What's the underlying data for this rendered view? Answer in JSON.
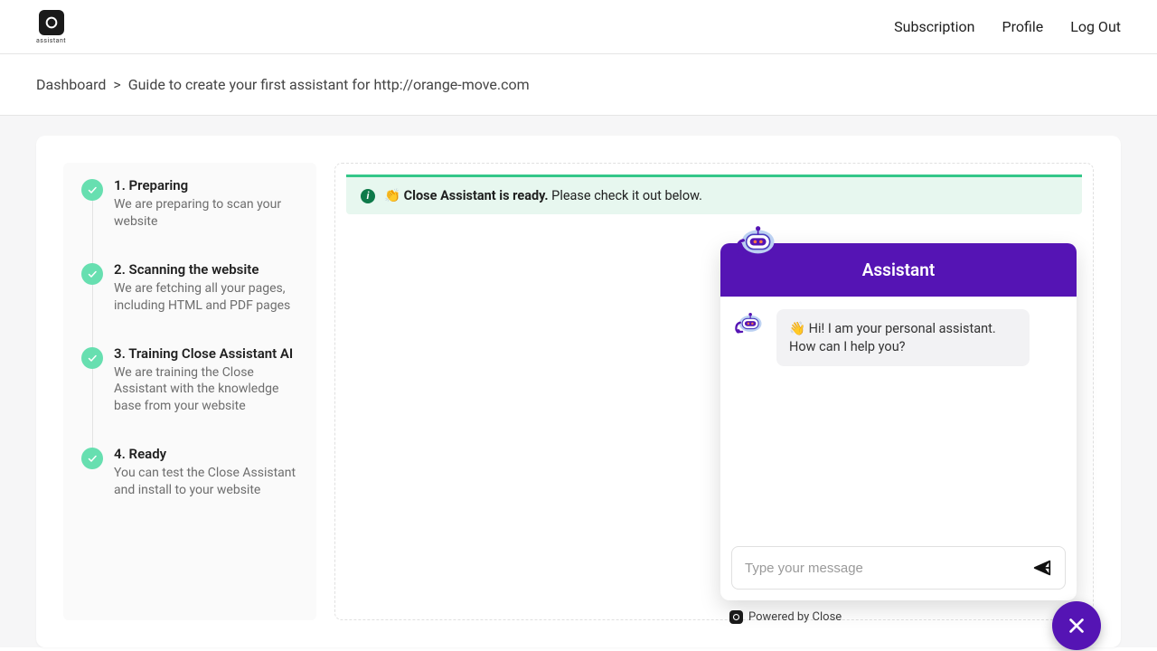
{
  "logo": {
    "caption": "assistant"
  },
  "nav": {
    "subscription": "Subscription",
    "profile": "Profile",
    "logout": "Log Out"
  },
  "breadcrumb": {
    "dashboard": "Dashboard",
    "sep": ">",
    "current": "Guide to create your first assistant for http://orange-move.com"
  },
  "steps": [
    {
      "title": "1. Preparing",
      "desc": "We are preparing to scan your website"
    },
    {
      "title": "2. Scanning the website",
      "desc": "We are fetching all your pages, including HTML and PDF pages"
    },
    {
      "title": "3. Training Close Assistant AI",
      "desc": "We are training the Close Assistant with the knowledge base from your website"
    },
    {
      "title": "4. Ready",
      "desc": "You can test the Close Assistant and install to your website"
    }
  ],
  "alert": {
    "emoji": "👏",
    "strong": "Close Assistant is ready.",
    "rest": " Please check it out below."
  },
  "chat": {
    "header": "Assistant",
    "greeting": "👋 Hi! I am your personal assistant. How can I help you?",
    "placeholder": "Type your message",
    "powered": "Powered by Close"
  }
}
